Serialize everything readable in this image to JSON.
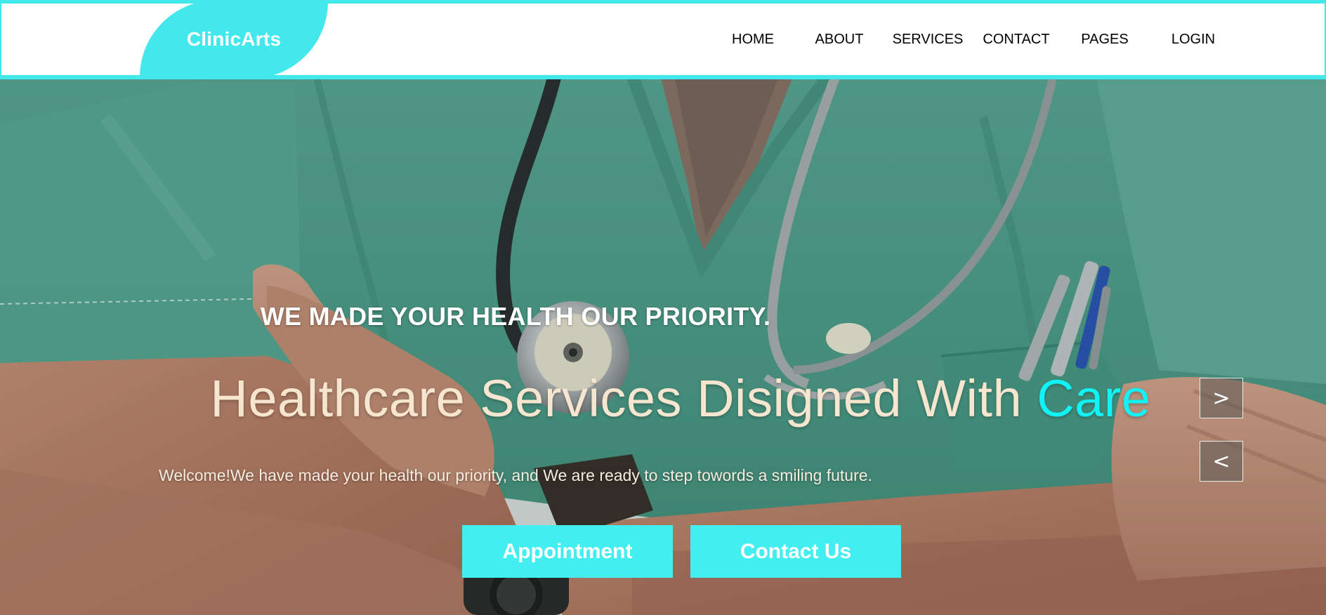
{
  "brand": {
    "name": "ClinicArts"
  },
  "nav": {
    "items": [
      {
        "label": "HOME"
      },
      {
        "label": "ABOUT"
      },
      {
        "label": "SERVICES"
      },
      {
        "label": "CONTACT"
      },
      {
        "label": "PAGES"
      },
      {
        "label": "LOGIN"
      }
    ]
  },
  "hero": {
    "kicker": "WE MADE YOUR HEALTH OUR PRIORITY.",
    "headline_main": "Healthcare Services Disigned With ",
    "headline_accent": "Care",
    "tagline": "Welcome!We have made your health our priority, and We are ready to step towords a smiling future.",
    "buttons": {
      "appointment": "Appointment",
      "contact": "Contact Us"
    },
    "slider": {
      "next": ">",
      "prev": "<"
    }
  },
  "colors": {
    "accent": "#43e8ec",
    "headline_text": "#f7e6cf",
    "headline_accent": "#12f2f5",
    "scrubs": "#5fa592"
  },
  "icons": {
    "next": "chevron-right-icon",
    "prev": "chevron-left-icon"
  }
}
